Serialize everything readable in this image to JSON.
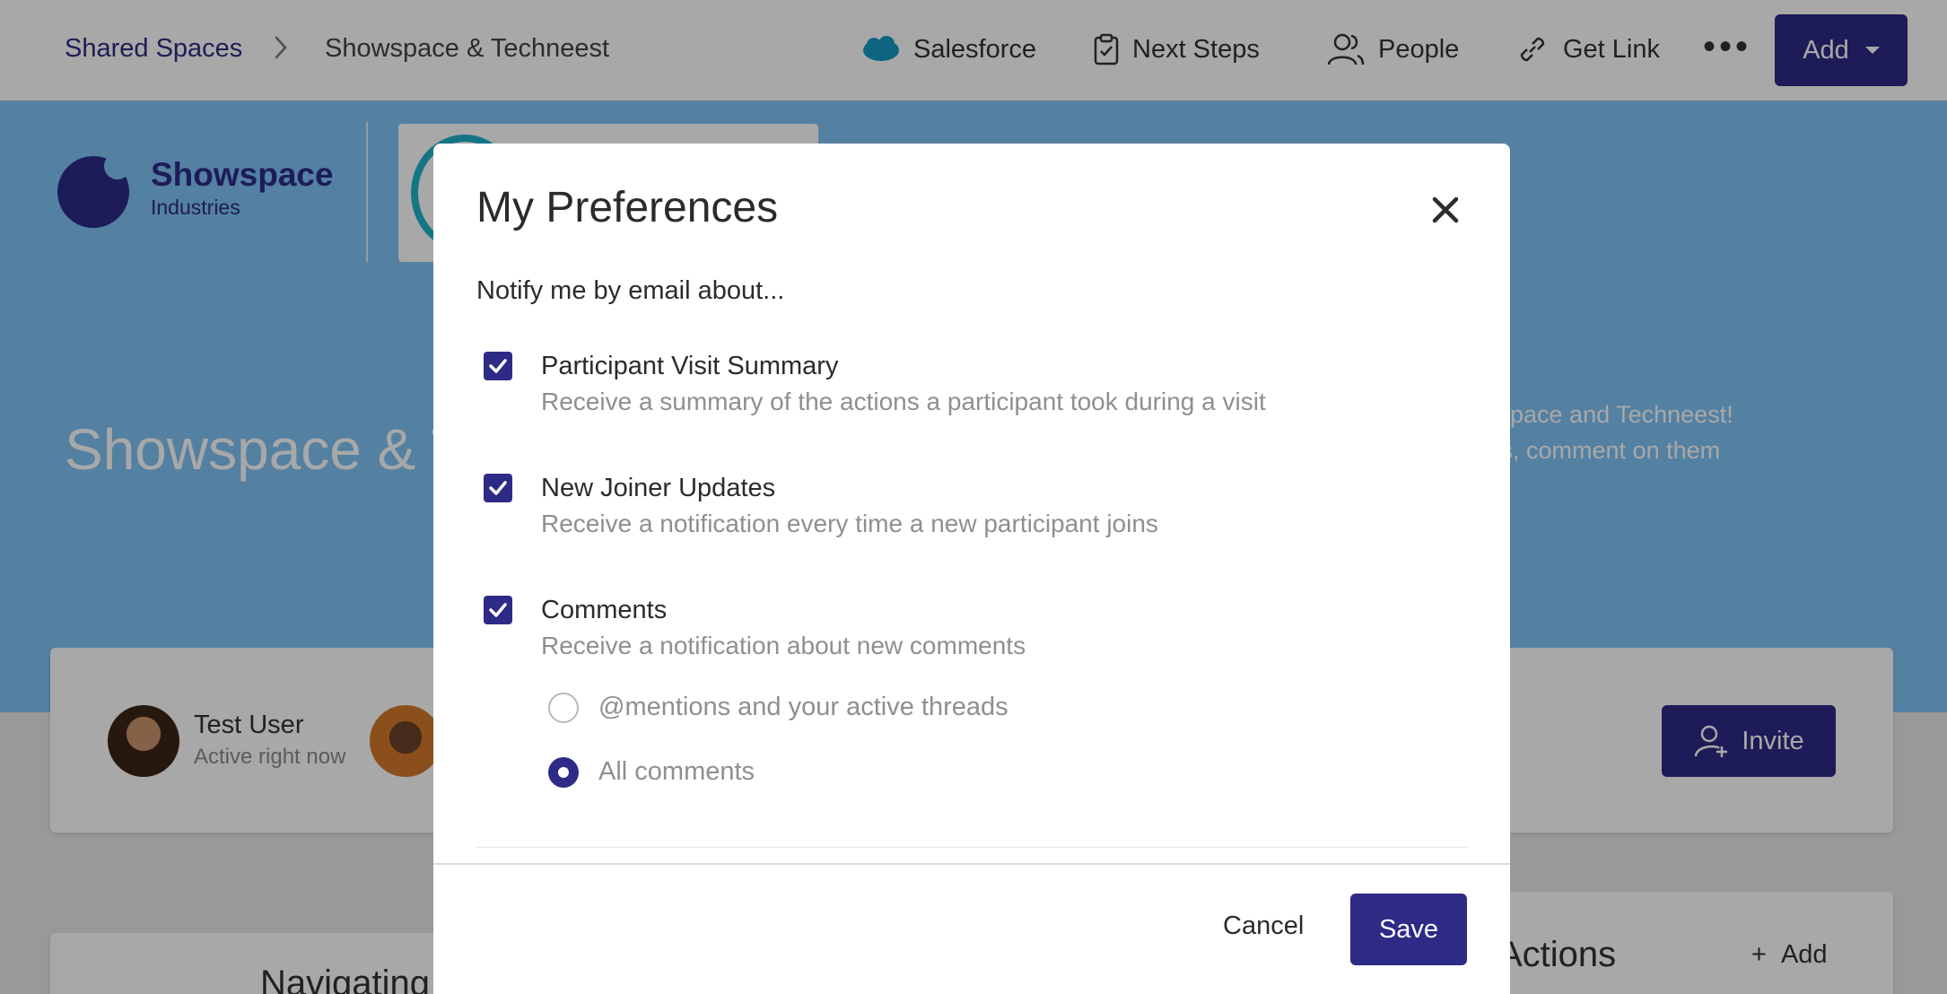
{
  "breadcrumb": {
    "parent": "Shared Spaces",
    "current": "Showspace & Techneest"
  },
  "topbar": {
    "salesforce_label": "Salesforce",
    "next_steps_label": "Next Steps",
    "people_label": "People",
    "get_link_label": "Get Link",
    "more_label": "•••",
    "add_label": "Add"
  },
  "hero": {
    "brand_name": "Showspace",
    "brand_sub": "Industries",
    "title": "Showspace & T",
    "description_line1": "wspace and Techneest!",
    "description_line2": "ets, comment on them"
  },
  "people_card": {
    "user_name": "Test User",
    "user_status": "Active right now",
    "invite_label": "Invite"
  },
  "nav_card": {
    "title": "Navigating"
  },
  "actions_card": {
    "title": "Actions",
    "add_label": "Add",
    "add_icon": "+"
  },
  "modal": {
    "title": "My Preferences",
    "subtitle": "Notify me by email about...",
    "preferences": [
      {
        "label": "Participant Visit Summary",
        "description": "Receive a summary of the actions a participant took during a visit",
        "checked": true
      },
      {
        "label": "New Joiner Updates",
        "description": "Receive a notification every time a new participant joins",
        "checked": true
      },
      {
        "label": "Comments",
        "description": "Receive a notification about new comments",
        "checked": true
      }
    ],
    "comment_options": [
      {
        "label": "@mentions and your active threads",
        "selected": false
      },
      {
        "label": "All comments",
        "selected": true
      }
    ],
    "cancel_label": "Cancel",
    "save_label": "Save"
  },
  "colors": {
    "primary": "#2d2b86",
    "hero_bg": "#80c3f6",
    "muted_text": "#8f8f8f"
  }
}
